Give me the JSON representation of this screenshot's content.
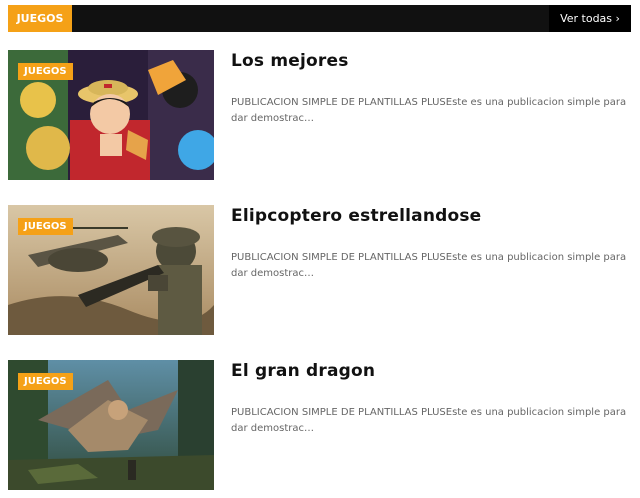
{
  "section": {
    "title": "JUEGOS",
    "view_all": "Ver todas"
  },
  "colors": {
    "accent": "#f5a117",
    "header_bg": "#111111",
    "title_text": "#111111",
    "snippet_text": "#666666"
  },
  "posts": [
    {
      "label": "JUEGOS",
      "title": "Los mejores",
      "snippet": "PUBLICACION SIMPLE DE PLANTILLAS PLUSEste es una publicacion simple para dar demostrac…",
      "thumbnail": "anime-characters-image"
    },
    {
      "label": "JUEGOS",
      "title": "Elipcoptero estrellandose",
      "snippet": "PUBLICACION SIMPLE DE PLANTILLAS PLUSEste es una publicacion simple para dar demostrac…",
      "thumbnail": "soldier-helicopter-image"
    },
    {
      "label": "JUEGOS",
      "title": "El gran dragon",
      "snippet": "PUBLICACION SIMPLE DE PLANTILLAS PLUSEste es una publicacion simple para dar demostrac…",
      "thumbnail": "dragon-game-image"
    }
  ]
}
